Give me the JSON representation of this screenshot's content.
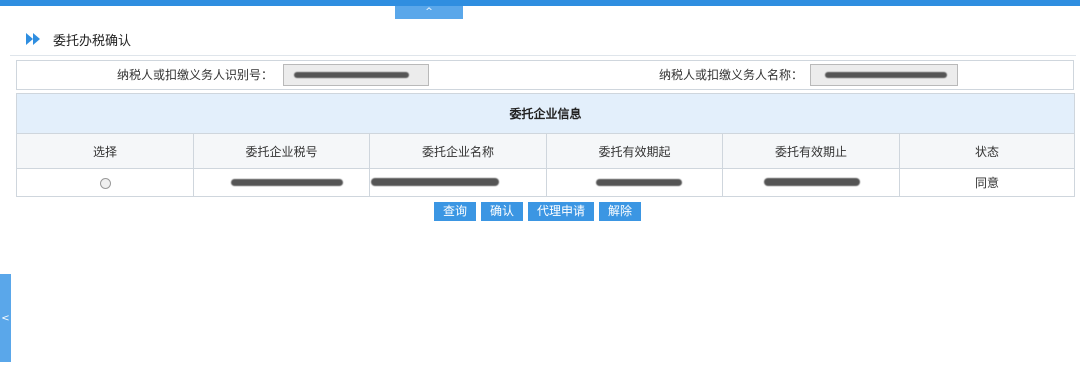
{
  "collapse_tab": {
    "glyph": "^"
  },
  "side_tab": {
    "glyph": "<"
  },
  "header": {
    "title": "委托办税确认"
  },
  "info": {
    "taxpayer_id_label": "纳税人或扣缴义务人识别号：",
    "taxpayer_name_label": "纳税人或扣缴义务人名称："
  },
  "table": {
    "caption": "委托企业信息",
    "columns": [
      "选择",
      "委托企业税号",
      "委托企业名称",
      "委托有效期起",
      "委托有效期止",
      "状态"
    ],
    "rows": [
      {
        "status": "同意"
      }
    ]
  },
  "buttons": {
    "query": "查询",
    "confirm": "确认",
    "agent_apply": "代理申请",
    "release": "解除"
  },
  "colors": {
    "accent": "#2f8ee0",
    "button": "#3b96e3",
    "caption_bg": "#e3effb"
  }
}
